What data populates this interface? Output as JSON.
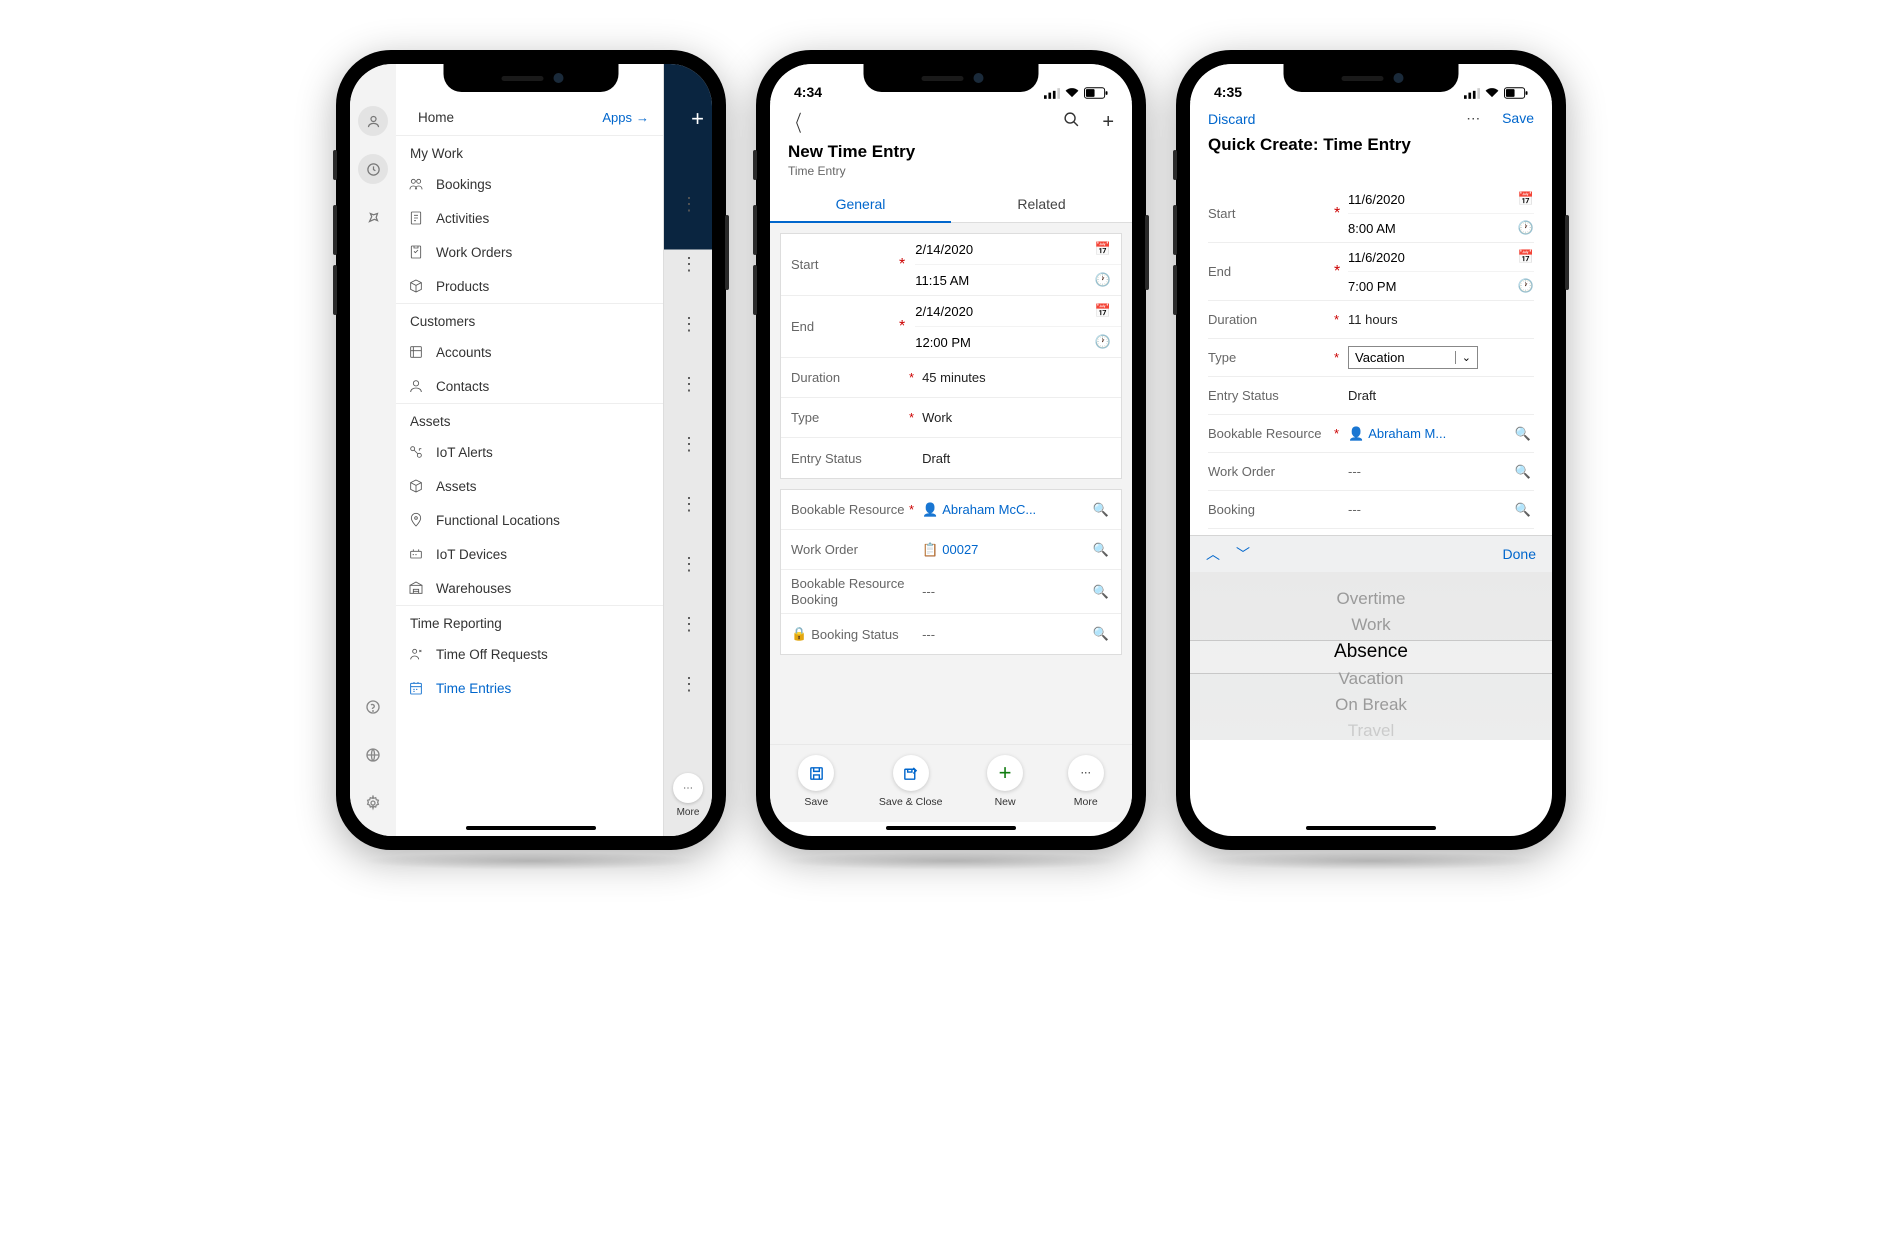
{
  "phone1": {
    "home_label": "Home",
    "apps_label": "Apps",
    "groups": [
      {
        "header": "My Work",
        "items": [
          {
            "label": "Bookings"
          },
          {
            "label": "Activities"
          },
          {
            "label": "Work Orders"
          },
          {
            "label": "Products"
          }
        ]
      },
      {
        "header": "Customers",
        "items": [
          {
            "label": "Accounts"
          },
          {
            "label": "Contacts"
          }
        ]
      },
      {
        "header": "Assets",
        "items": [
          {
            "label": "IoT Alerts"
          },
          {
            "label": "Assets"
          },
          {
            "label": "Functional Locations"
          },
          {
            "label": "IoT Devices"
          },
          {
            "label": "Warehouses"
          }
        ]
      },
      {
        "header": "Time Reporting",
        "items": [
          {
            "label": "Time Off Requests"
          },
          {
            "label": "Time Entries",
            "active": true
          }
        ]
      }
    ],
    "more_label": "More"
  },
  "phone2": {
    "time": "4:34",
    "title": "New Time Entry",
    "subtitle": "Time Entry",
    "tabs": [
      "General",
      "Related"
    ],
    "start_label": "Start",
    "start_date": "2/14/2020",
    "start_time": "11:15 AM",
    "end_label": "End",
    "end_date": "2/14/2020",
    "end_time": "12:00 PM",
    "duration_label": "Duration",
    "duration_value": "45 minutes",
    "type_label": "Type",
    "type_value": "Work",
    "status_label": "Entry Status",
    "status_value": "Draft",
    "bookres_label": "Bookable Resource",
    "bookres_value": "Abraham McC...",
    "workorder_label": "Work Order",
    "workorder_value": "00027",
    "brb_label": "Bookable Resource Booking",
    "brb_value": "---",
    "bookstatus_label": "Booking Status",
    "bookstatus_value": "---",
    "buttons": {
      "save": "Save",
      "saveclose": "Save & Close",
      "new": "New",
      "more": "More"
    }
  },
  "phone3": {
    "time": "4:35",
    "discard": "Discard",
    "save": "Save",
    "title": "Quick Create: Time Entry",
    "start_label": "Start",
    "start_date": "11/6/2020",
    "start_time": "8:00 AM",
    "end_label": "End",
    "end_date": "11/6/2020",
    "end_time": "7:00 PM",
    "duration_label": "Duration",
    "duration_value": "11 hours",
    "type_label": "Type",
    "type_value": "Vacation",
    "status_label": "Entry Status",
    "status_value": "Draft",
    "bookres_label": "Bookable Resource",
    "bookres_value": "Abraham M...",
    "workorder_label": "Work Order",
    "workorder_value": "---",
    "booking_label": "Booking",
    "booking_value": "---",
    "done": "Done",
    "picker": [
      "Overtime",
      "Work",
      "Absence",
      "Vacation",
      "On Break",
      "Travel"
    ],
    "picker_selected": "Absence"
  }
}
